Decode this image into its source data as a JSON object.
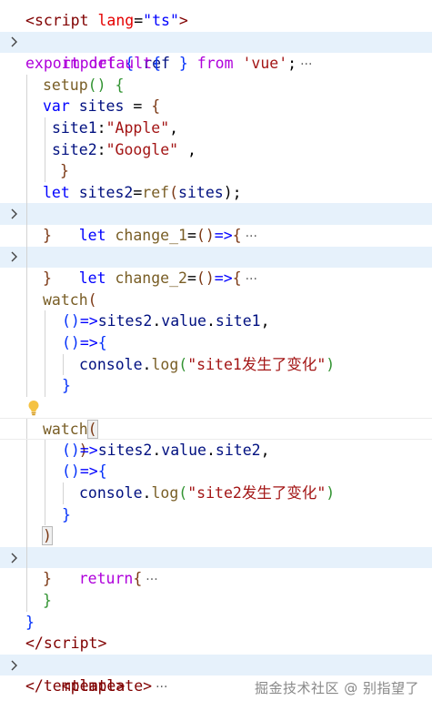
{
  "code": {
    "l1": {
      "a": "<",
      "b": "script",
      "c": " ",
      "d": "lang",
      "e": "=",
      "f": "\"ts\"",
      "g": ">"
    },
    "l2": {
      "a": "import",
      "b": " { ",
      "c": "ref",
      "d": " } ",
      "e": "from",
      "f": " ",
      "g": "'vue'",
      "h": ";"
    },
    "l3": {
      "a": "export",
      "b": " ",
      "c": "default",
      "d": "{"
    },
    "l4": {
      "a": "setup",
      "b": "() ",
      "c": "{"
    },
    "l5": {
      "a": "var",
      "b": " ",
      "c": "sites",
      "d": " = ",
      "e": "{"
    },
    "l6": {
      "a": "site1",
      "b": ":",
      "c": "\"Apple\"",
      "d": ","
    },
    "l7": {
      "a": "site2",
      "b": ":",
      "c": "\"Google\"",
      "d": " ,"
    },
    "l8": {
      "a": "}"
    },
    "l9": {
      "a": "let",
      "b": " ",
      "c": "sites2",
      "d": "=",
      "e": "ref",
      "f": "(",
      "g": "sites",
      "h": ");"
    },
    "l10": {
      "a": "let",
      "b": " ",
      "c": "change_1",
      "d": "=",
      "e": "()",
      "f": "=>",
      "g": "{"
    },
    "l11": {
      "a": "}"
    },
    "l12": {
      "a": "let",
      "b": " ",
      "c": "change_2",
      "d": "=",
      "e": "()",
      "f": "=>",
      "g": "{"
    },
    "l13": {
      "a": "}"
    },
    "l14": {
      "a": "watch",
      "b": "("
    },
    "l15": {
      "a": "()",
      "b": "=>",
      "c": "sites2",
      "d": ".",
      "e": "value",
      "f": ".",
      "g": "site1",
      "h": ","
    },
    "l16": {
      "a": "()",
      "b": "=>",
      "c": "{"
    },
    "l17": {
      "a": "console",
      "b": ".",
      "c": "log",
      "d": "(",
      "e": "\"site1发生了变化\"",
      "f": ")"
    },
    "l18": {
      "a": "}"
    },
    "l19": {
      "a": ")"
    },
    "l20": {
      "a": "watch",
      "b": "("
    },
    "l21": {
      "a": "()",
      "b": "=>",
      "c": "sites2",
      "d": ".",
      "e": "value",
      "f": ".",
      "g": "site2",
      "h": ","
    },
    "l22": {
      "a": "()",
      "b": "=>",
      "c": "{"
    },
    "l23": {
      "a": "console",
      "b": ".",
      "c": "log",
      "d": "(",
      "e": "\"site2发生了变化\"",
      "f": ")"
    },
    "l24": {
      "a": "}"
    },
    "l25": {
      "a": ")"
    },
    "l26": {
      "a": "return",
      "b": "{"
    },
    "l27": {
      "a": "}"
    },
    "l28": {
      "a": "}"
    },
    "l29": {
      "a": "}"
    },
    "l30": {
      "a": "</",
      "b": "script",
      "c": ">"
    },
    "l31": {
      "a": "<",
      "b": "template",
      "c": ">"
    },
    "l32": {
      "a": "</",
      "b": "template",
      "c": ">"
    }
  },
  "fold_ellipsis": "···",
  "watermark": "掘金技术社区 @ 别指望了",
  "icons": {
    "fold": "chevron-right-icon",
    "hint": "lightbulb-icon"
  },
  "colors": {
    "fold_bg": "#e6f1fb",
    "bulb": "#f5c242"
  }
}
